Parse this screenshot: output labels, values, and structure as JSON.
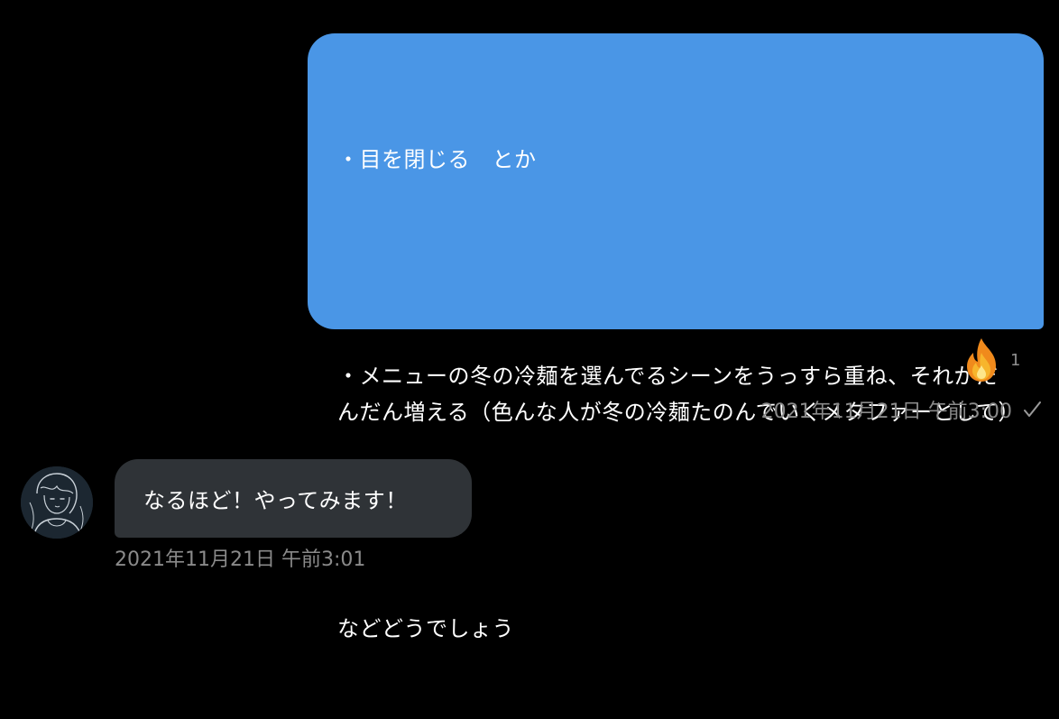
{
  "colors": {
    "background": "#000000",
    "outgoing_bubble": "#4a96e6",
    "incoming_bubble": "#2f3337",
    "meta_text": "#8a8a8a"
  },
  "messages": {
    "outgoing": {
      "paragraphs": [
        "・目を閉じる　とか",
        "・メニューの冬の冷麺を選んでるシーンをうっすら重ね、それがだんだん増える（色んな人が冬の冷麺たのんでいくメタファーとして）",
        "などどうでしょう"
      ],
      "reaction_icon": "fire-emoji",
      "reaction_count": "1",
      "timestamp": "2021年11月21日 午前3:00",
      "status_icon": "checkmark-icon"
    },
    "incoming": {
      "text": "なるほど！やってみます！",
      "timestamp": "2021年11月21日 午前3:01",
      "avatar_icon": "line-art-portrait-avatar"
    }
  }
}
